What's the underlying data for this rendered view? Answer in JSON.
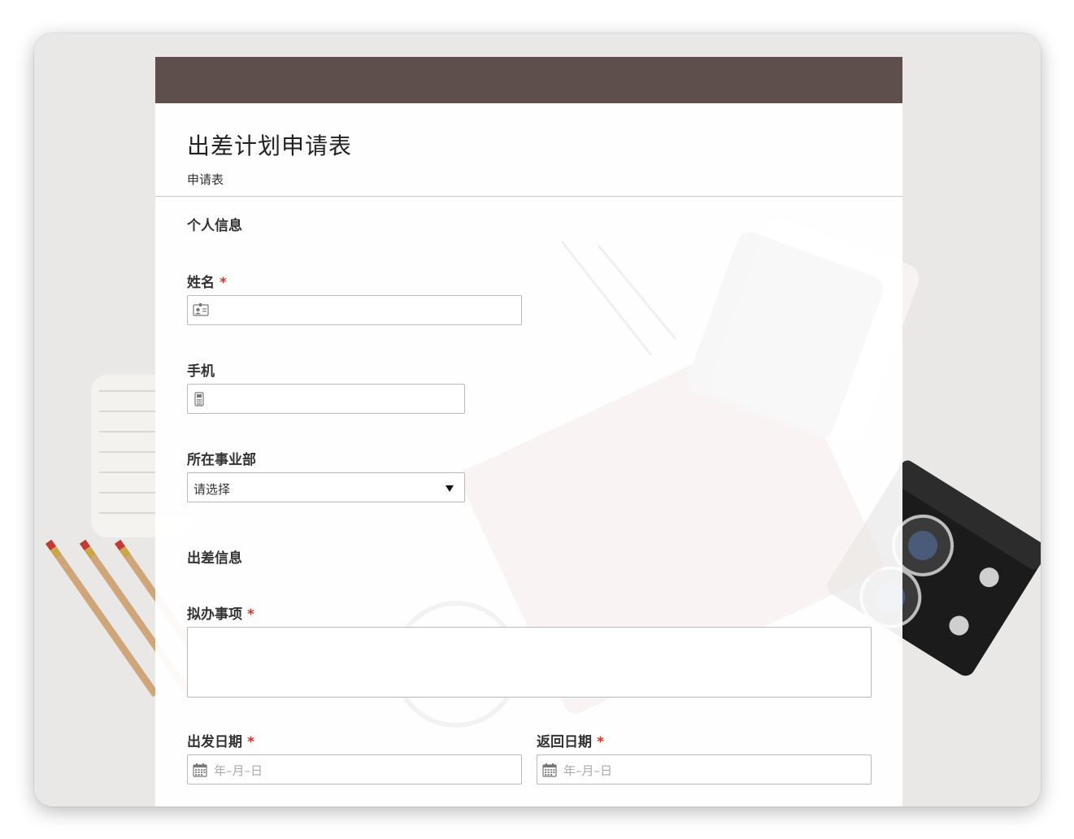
{
  "form": {
    "title": "出差计划申请表",
    "subtitle": "申请表",
    "sections": {
      "personal": "个人信息",
      "trip": "出差信息"
    },
    "fields": {
      "name": {
        "label": "姓名",
        "required_mark": "*",
        "value": ""
      },
      "phone": {
        "label": "手机",
        "value": ""
      },
      "department": {
        "label": "所在事业部",
        "selected": "请选择"
      },
      "matters": {
        "label": "拟办事项",
        "required_mark": "*",
        "value": ""
      },
      "depart_date": {
        "label": "出发日期",
        "required_mark": "*",
        "placeholder": "年–月–日"
      },
      "return_date": {
        "label": "返回日期",
        "required_mark": "*",
        "placeholder": "年–月–日"
      }
    }
  },
  "icons": {
    "name_field": "id-card-icon",
    "phone_field": "mobile-phone-icon",
    "department_select": "caret-down-icon",
    "date_field": "calendar-icon"
  },
  "colors": {
    "header_band": "#5f4f4c",
    "required": "#d9342b",
    "page_bg": "#e9e8e6"
  }
}
